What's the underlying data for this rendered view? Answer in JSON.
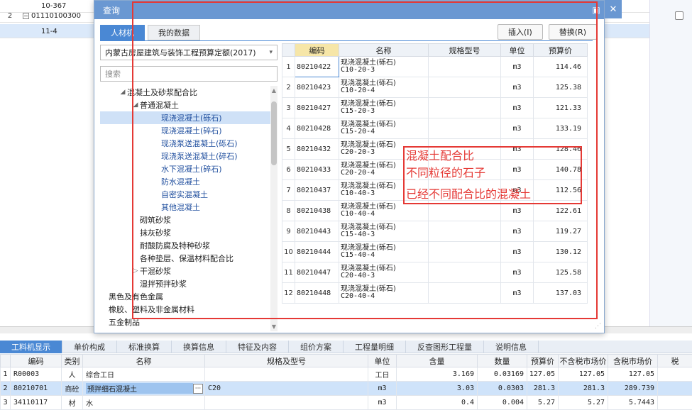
{
  "background": {
    "rows": [
      {
        "num": "",
        "code": "10-367"
      },
      {
        "num": "2",
        "code": "01110100300"
      },
      {
        "num": "",
        "code": "11-4"
      }
    ]
  },
  "dialog": {
    "title": "查询",
    "minimize_glyph": "▣",
    "close_glyph": "✕",
    "tabs": [
      "人材机",
      "我的数据"
    ],
    "buttons": {
      "insert": "插入(I)",
      "replace": "替换(R)"
    },
    "quota_selector": {
      "value": "内蒙古房屋建筑与装饰工程预算定额(2017)"
    },
    "search": {
      "placeholder": "搜索"
    },
    "tree": [
      {
        "label": "混凝土及砂浆配合比",
        "level": 1,
        "expander": "◢"
      },
      {
        "label": "普通混凝土",
        "level": 2,
        "expander": "◢"
      },
      {
        "label": "现浇混凝土(砾石)",
        "level": 3,
        "selected": true
      },
      {
        "label": "现浇混凝土(碎石)",
        "level": 3
      },
      {
        "label": "现浇泵送混凝土(砾石)",
        "level": 3
      },
      {
        "label": "现浇泵送混凝土(碎石)",
        "level": 3
      },
      {
        "label": "水下混凝土(碎石)",
        "level": 3
      },
      {
        "label": "防水混凝土",
        "level": 3
      },
      {
        "label": "自密实混凝土",
        "level": 3
      },
      {
        "label": "其他混凝土",
        "level": 3
      },
      {
        "label": "砌筑砂浆",
        "level": 2
      },
      {
        "label": "抹灰砂浆",
        "level": 2
      },
      {
        "label": "耐酸防腐及特种砂浆",
        "level": 2
      },
      {
        "label": "各种垫层、保温材料配合比",
        "level": 2
      },
      {
        "label": "干混砂浆",
        "level": 2,
        "expander": "▷"
      },
      {
        "label": "湿拌预拌砂浆",
        "level": 2
      },
      {
        "label": "黑色及有色金属",
        "level": 1
      },
      {
        "label": "橡胶、塑料及非金属材料",
        "level": 1
      },
      {
        "label": "五金制品",
        "level": 1
      }
    ],
    "table": {
      "headers": [
        "编码",
        "名称",
        "规格型号",
        "单位",
        "预算价"
      ],
      "rows": [
        {
          "num": "1",
          "code": "80210422",
          "name1": "现浇混凝土(砾石)",
          "name2": "C10-20-3",
          "spec": "",
          "unit": "m3",
          "price": "114.46"
        },
        {
          "num": "2",
          "code": "80210423",
          "name1": "现浇混凝土(砾石)",
          "name2": "C10-20-4",
          "spec": "",
          "unit": "m3",
          "price": "125.38"
        },
        {
          "num": "3",
          "code": "80210427",
          "name1": "现浇混凝土(砾石)",
          "name2": "C15-20-3",
          "spec": "",
          "unit": "m3",
          "price": "121.33"
        },
        {
          "num": "4",
          "code": "80210428",
          "name1": "现浇混凝土(砾石)",
          "name2": "C15-20-4",
          "spec": "",
          "unit": "m3",
          "price": "133.19"
        },
        {
          "num": "5",
          "code": "80210432",
          "name1": "现浇混凝土(砾石)",
          "name2": "C20-20-3",
          "spec": "",
          "unit": "m3",
          "price": "128.46"
        },
        {
          "num": "6",
          "code": "80210433",
          "name1": "现浇混凝土(砾石)",
          "name2": "C20-20-4",
          "spec": "",
          "unit": "m3",
          "price": "140.78"
        },
        {
          "num": "7",
          "code": "80210437",
          "name1": "现浇混凝土(砾石)",
          "name2": "C10-40-3",
          "spec": "",
          "unit": "m3",
          "price": "112.56"
        },
        {
          "num": "8",
          "code": "80210438",
          "name1": "现浇混凝土(砾石)",
          "name2": "C10-40-4",
          "spec": "",
          "unit": "m3",
          "price": "122.61"
        },
        {
          "num": "9",
          "code": "80210443",
          "name1": "现浇混凝土(砾石)",
          "name2": "C15-40-3",
          "spec": "",
          "unit": "m3",
          "price": "119.27"
        },
        {
          "num": "10",
          "code": "80210444",
          "name1": "现浇混凝土(砾石)",
          "name2": "C15-40-4",
          "spec": "",
          "unit": "m3",
          "price": "130.12"
        },
        {
          "num": "11",
          "code": "80210447",
          "name1": "现浇混凝土(砾石)",
          "name2": "C20-40-3",
          "spec": "",
          "unit": "m3",
          "price": "125.58"
        },
        {
          "num": "12",
          "code": "80210448",
          "name1": "现浇混凝土(砾石)",
          "name2": "C20-40-4",
          "spec": "",
          "unit": "m3",
          "price": "137.03"
        }
      ]
    }
  },
  "annotation": {
    "lines": [
      "混凝土配合比",
      "不同粒径的石子",
      "已经不同配合比的混凝土"
    ],
    "color": "#e53935"
  },
  "bottom": {
    "tabs": [
      "工料机显示",
      "单价构成",
      "标准换算",
      "换算信息",
      "特征及内容",
      "组价方案",
      "工程量明细",
      "反查图形工程量",
      "说明信息"
    ],
    "headers": [
      "",
      "编码",
      "类别",
      "名称",
      "规格及型号",
      "单位",
      "含量",
      "数量",
      "预算价",
      "不含税市场价",
      "含税市场价",
      "税"
    ],
    "rows": [
      {
        "num": "1",
        "code": "R00003",
        "type": "人",
        "name": "综合工日",
        "spec": "",
        "unit": "工日",
        "content": "3.169",
        "qty": "0.03169",
        "budget": "127.05",
        "market_ex": "127.05",
        "market_in": "127.05"
      },
      {
        "num": "2",
        "code": "80210701",
        "type": "商砼",
        "name": "预拌细石混凝土",
        "dots": "···",
        "spec": "C20",
        "unit": "m3",
        "content": "3.03",
        "qty": "0.0303",
        "budget": "281.3",
        "market_ex": "281.3",
        "market_in": "289.739"
      },
      {
        "num": "3",
        "code": "34110117",
        "type": "材",
        "name": "水",
        "spec": "",
        "unit": "m3",
        "content": "0.4",
        "qty": "0.004",
        "budget": "5.27",
        "market_ex": "5.27",
        "market_in": "5.7443"
      }
    ]
  }
}
